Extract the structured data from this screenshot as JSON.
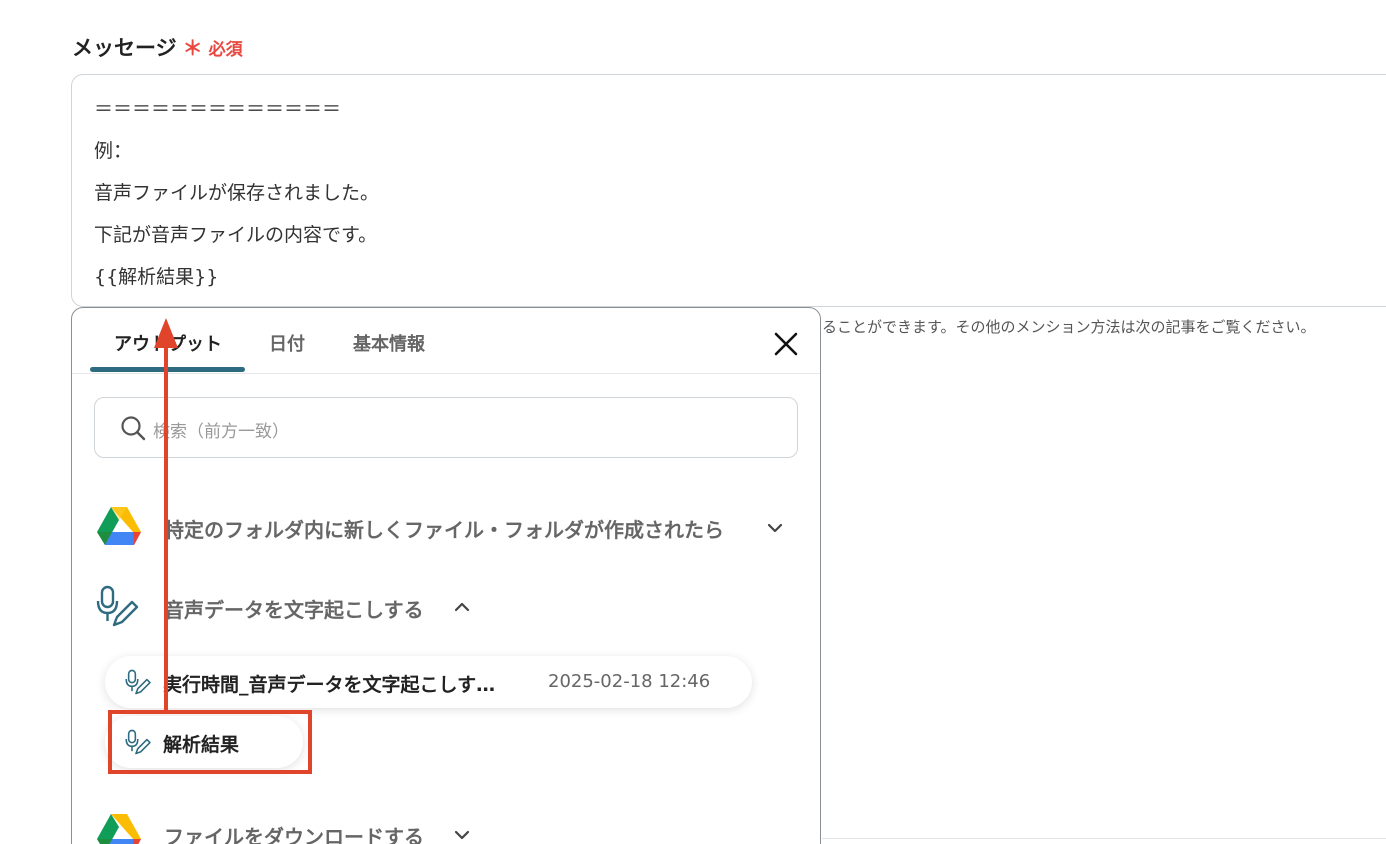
{
  "field": {
    "label": "メッセージ",
    "required_mark": "＊",
    "required_text": "必須"
  },
  "message": {
    "lines": [
      "＝＝＝＝＝＝＝＝＝＝＝＝＝",
      "例：",
      "音声ファイルが保存されました。",
      "下記が音声ファイルの内容です。",
      "{{解析結果}}"
    ]
  },
  "help_text": "ることができます。その他のメンション方法は次の記事をご覧ください。",
  "dropdown": {
    "tabs": [
      {
        "label": "アウトプット",
        "active": true
      },
      {
        "label": "日付",
        "active": false
      },
      {
        "label": "基本情報",
        "active": false
      }
    ],
    "search_placeholder": "検索（前方一致）",
    "sections": [
      {
        "title": "特定のフォルダ内に新しくファイル・フォルダが作成されたら",
        "icon": "google-drive-icon",
        "expanded": false
      },
      {
        "title": "音声データを文字起こしする",
        "icon": "microphone-pen-icon",
        "expanded": true
      },
      {
        "title": "ファイルをダウンロードする",
        "icon": "google-drive-icon",
        "expanded": false
      }
    ],
    "outputs": [
      {
        "name": "実行時間_音声データを文字起こしす…",
        "value": "2025-02-18 12:46"
      },
      {
        "name": "解析結果",
        "value": ""
      }
    ]
  },
  "colors": {
    "accent": "#2f6b80",
    "required": "#e8483f",
    "annotation": "#e0442b"
  }
}
